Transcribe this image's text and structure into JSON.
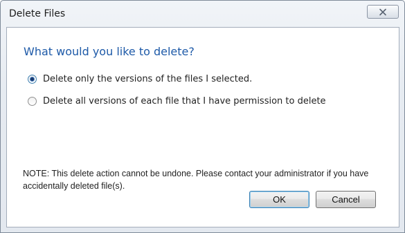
{
  "window": {
    "title": "Delete Files",
    "close_label": "✕"
  },
  "dialog": {
    "heading": "What would you like to delete?",
    "options": [
      {
        "label": "Delete only the versions of the files I selected.",
        "selected": true
      },
      {
        "label": "Delete all versions of each file that I have permission to delete",
        "selected": false
      }
    ],
    "note": "NOTE: This delete action cannot be undone. Please contact your administrator if you have accidentally deleted file(s)."
  },
  "buttons": {
    "ok_label": "OK",
    "cancel_label": "Cancel"
  },
  "colors": {
    "heading": "#1e5aa8",
    "ok_focus_border": "#3c7fb1"
  }
}
